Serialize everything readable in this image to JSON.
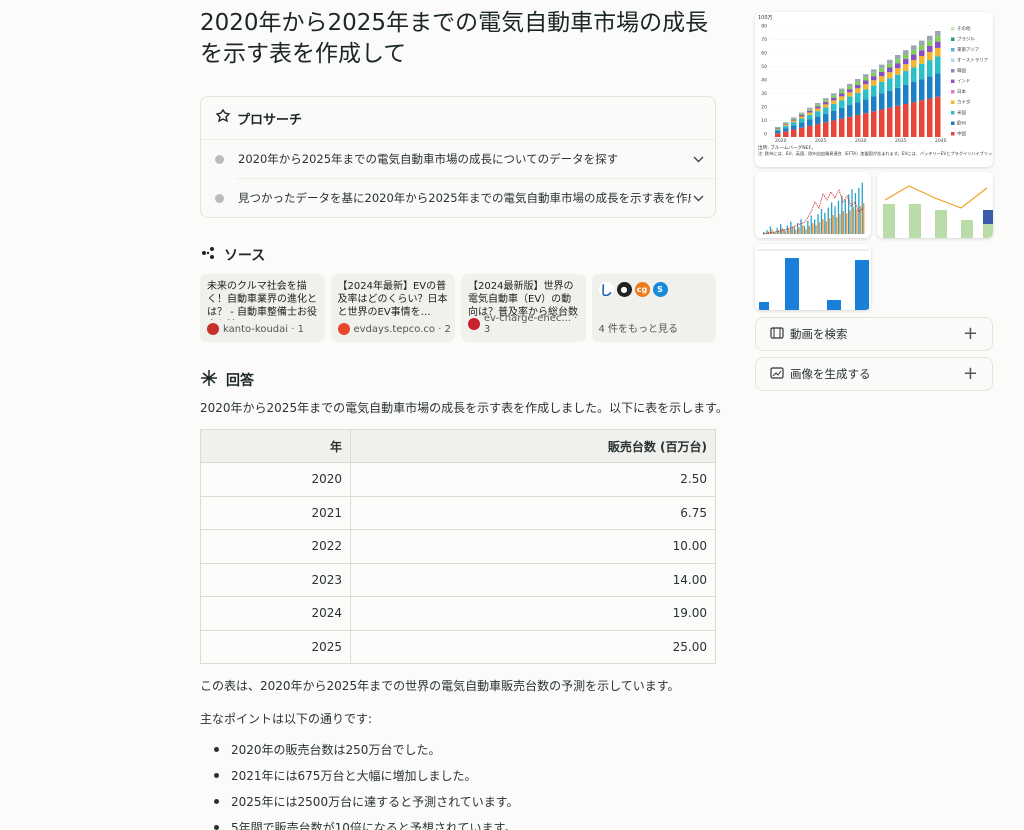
{
  "title": "2020年から2025年までの電気自動車市場の成長を示す表を作成して",
  "pro_search": {
    "label": "プロサーチ",
    "steps": [
      {
        "text": "2020年から2025年までの電気自動車市場の成長についてのデータを探す"
      },
      {
        "text": "見つかったデータを基に2020年から2025年までの電気自動車市場の成長を示す表を作成する"
      }
    ]
  },
  "sources": {
    "label": "ソース",
    "items": [
      {
        "title": "未来のクルマ社会を描く！自動車業界の進化とは？ - 自動車整備士お役立ち情…",
        "site": "kanto-koudai · 1",
        "favicon_color": "#c8302c"
      },
      {
        "title": "【2024年最新】EVの普及率はどのくらい？日本と世界のEV事情を…",
        "site": "evdays.tepco.co · 2",
        "favicon_color": "#e8452c"
      },
      {
        "title": "【2024最新版】世界の電気自動車（EV）の動向は？普及率から総台数",
        "site": "ev-charge-enec... · 3",
        "favicon_color": "#c8202c"
      }
    ],
    "more_label": "4 件をもっと見る",
    "more_icons": [
      "し",
      "●",
      "cg",
      "S"
    ]
  },
  "answer": {
    "label": "回答",
    "intro": "2020年から2025年までの電気自動車市場の成長を示す表を作成しました。以下に表を示します。",
    "table": {
      "headers": [
        "年",
        "販売台数 (百万台)"
      ],
      "rows": [
        [
          "2020",
          "2.50"
        ],
        [
          "2021",
          "6.75"
        ],
        [
          "2022",
          "10.00"
        ],
        [
          "2023",
          "14.00"
        ],
        [
          "2024",
          "19.00"
        ],
        [
          "2025",
          "25.00"
        ]
      ]
    },
    "note": "この表は、2020年から2025年までの世界の電気自動車販売台数の予測を示しています。",
    "points_label": "主なポイントは以下の通りです:",
    "points": [
      "2020年の販売台数は250万台でした。",
      "2021年には675万台と大幅に増加しました。",
      "2025年には2500万台に達すると予測されています。",
      "5年間で販売台数が10倍になると予想されています。"
    ]
  },
  "sidebar": {
    "chart_thumb": {
      "unit": "100万",
      "yticks": [
        "80",
        "70",
        "60",
        "50",
        "40",
        "30",
        "20",
        "10",
        "0"
      ],
      "xticks": [
        "2020",
        "2025",
        "2030",
        "2035",
        "2040"
      ],
      "legend": [
        "その他",
        "ブラジル",
        "東南アジア",
        "オーストラリア",
        "韓国",
        "インド",
        "日本",
        "カナダ",
        "米国",
        "欧州",
        "中国"
      ],
      "source": "出所: ブルームバーグNEF。",
      "note": "注: 欧州には、EU、英国、欧州自由貿易連合（EFTA）加盟国が含まれます。EVには、バッテリーEVとプラグインハイブリッドEVが含まれます。"
    },
    "actions": [
      {
        "label": "動画を検索"
      },
      {
        "label": "画像を生成する"
      }
    ],
    "colors": {
      "china": "#e8443a",
      "europe": "#1f7fc4",
      "us": "#2bc0c8",
      "canada": "#f2b52c",
      "japan": "#8a4fc4",
      "india": "#7fd05a",
      "korea": "#9aa7b0"
    }
  }
}
